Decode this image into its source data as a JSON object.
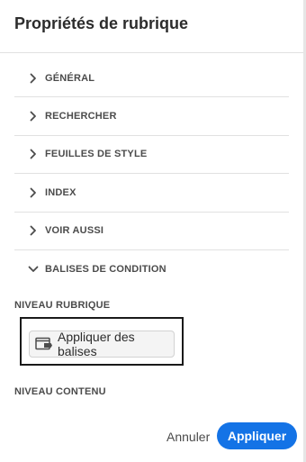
{
  "panel": {
    "title": "Propriétés de rubrique"
  },
  "sections": [
    {
      "label": "GÉNÉRAL",
      "expanded": false
    },
    {
      "label": "RECHERCHER",
      "expanded": false
    },
    {
      "label": "FEUILLES DE STYLE",
      "expanded": false
    },
    {
      "label": "INDEX",
      "expanded": false
    },
    {
      "label": "VOIR AUSSI",
      "expanded": false
    },
    {
      "label": "BALISES DE CONDITION",
      "expanded": true
    }
  ],
  "condition_tags": {
    "topic_level_label": "NIVEAU RUBRIQUE",
    "apply_tags_label": "Appliquer des balises",
    "content_level_label": "NIVEAU CONTENU"
  },
  "footer": {
    "cancel_label": "Annuler",
    "apply_label": "Appliquer"
  },
  "colors": {
    "accent": "#1473e6",
    "highlight_border": "#1a1a1a"
  }
}
